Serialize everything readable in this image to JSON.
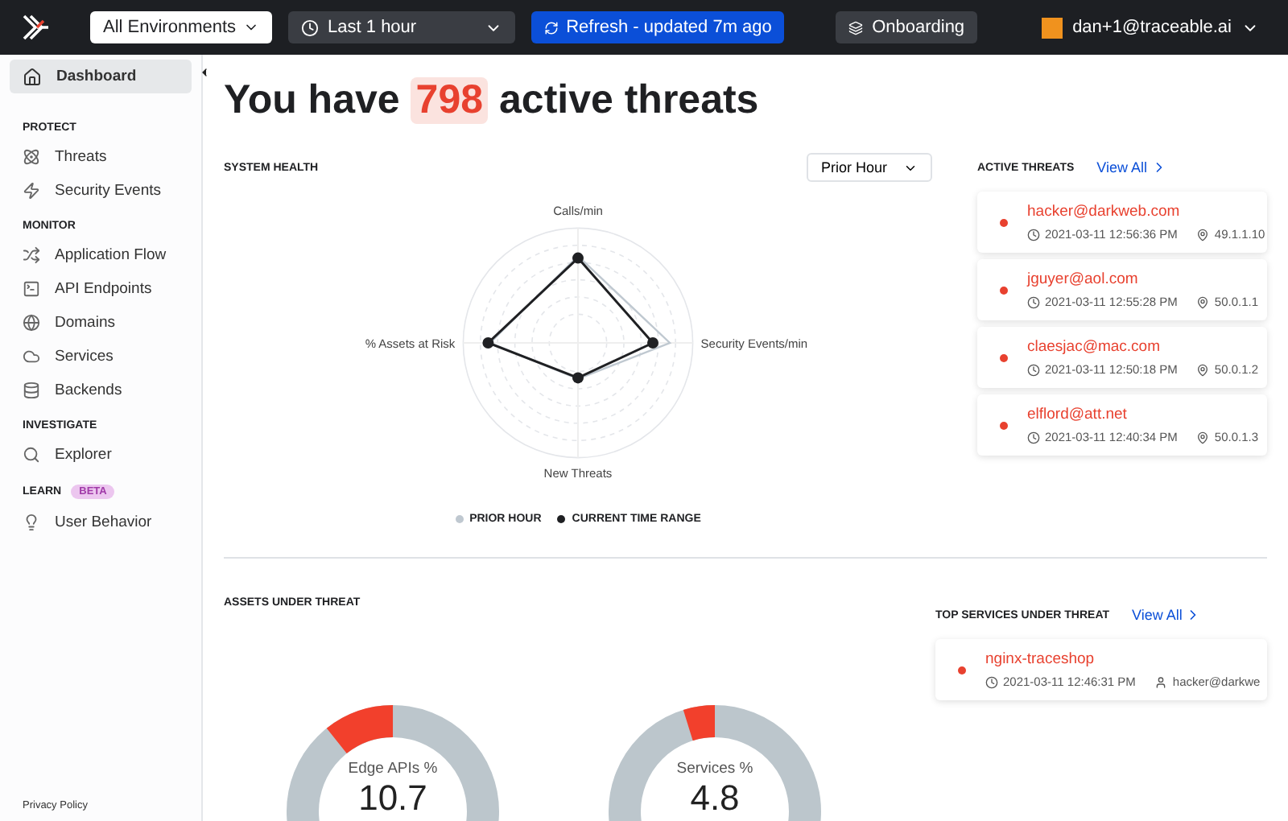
{
  "topbar": {
    "environment": "All Environments",
    "time_range": "Last 1 hour",
    "refresh": "Refresh - updated 7m ago",
    "onboarding": "Onboarding",
    "user": "dan+1@traceable.ai"
  },
  "sidebar": {
    "dashboard": {
      "label": "Dashboard",
      "selected": true
    },
    "sections": [
      {
        "title": "PROTECT",
        "items": [
          {
            "label": "Threats",
            "kind": "threats",
            "selected": false
          },
          {
            "label": "Security Events",
            "kind": "events",
            "selected": false
          }
        ]
      },
      {
        "title": "MONITOR",
        "items": [
          {
            "label": "Application Flow",
            "kind": "flow",
            "selected": false
          },
          {
            "label": "API Endpoints",
            "kind": "endpoints",
            "selected": false
          },
          {
            "label": "Domains",
            "kind": "domains",
            "selected": false
          },
          {
            "label": "Services",
            "kind": "services",
            "selected": false
          },
          {
            "label": "Backends",
            "kind": "backends",
            "selected": false
          }
        ]
      },
      {
        "title": "INVESTIGATE",
        "items": [
          {
            "label": "Explorer",
            "kind": "explorer",
            "selected": false
          }
        ]
      },
      {
        "title": "LEARN",
        "badge": "BETA",
        "items": [
          {
            "label": "User Behavior",
            "kind": "behavior",
            "selected": false
          }
        ]
      }
    ],
    "footer": "Privacy Policy"
  },
  "headline": {
    "before": "You have",
    "count": "798",
    "after": "active threats"
  },
  "system_health": {
    "title": "SYSTEM HEALTH",
    "period": "Prior Hour",
    "axes": [
      "Calls/min",
      "Security Events/min",
      "New Threats",
      "% Assets at Risk"
    ],
    "legend": [
      {
        "label": "PRIOR HOUR",
        "color": "#bfc8d0"
      },
      {
        "label": "CURRENT TIME RANGE",
        "color": "#1f2023"
      }
    ]
  },
  "active_threats": {
    "title": "ACTIVE THREATS",
    "link": "View All",
    "items": [
      {
        "name": "hacker@darkweb.com",
        "time": "2021-03-11 12:56:36 PM",
        "ip": "49.1.1.10",
        "color": "#e8412f"
      },
      {
        "name": "jguyer@aol.com",
        "time": "2021-03-11 12:55:28 PM",
        "ip": "50.0.1.1",
        "color": "#e8412f"
      },
      {
        "name": "claesjac@mac.com",
        "time": "2021-03-11 12:50:18 PM",
        "ip": "50.0.1.2",
        "color": "#e8412f"
      },
      {
        "name": "elflord@att.net",
        "time": "2021-03-11 12:40:34 PM",
        "ip": "50.0.1.3",
        "color": "#e8412f"
      }
    ]
  },
  "assets_under_threat": {
    "title": "ASSETS UNDER THREAT",
    "donuts": [
      {
        "label": "Edge APIs %",
        "value": "10.7",
        "level": 0.107
      },
      {
        "label": "Services %",
        "value": "4.8",
        "level": 0.048
      }
    ]
  },
  "top_services": {
    "title": "TOP SERVICES UNDER THREAT",
    "link": "View All",
    "items": [
      {
        "name": "nginx-traceshop",
        "time": "2021-03-11 12:46:31 PM",
        "user": "hacker@darkwe",
        "color": "#e8412f"
      }
    ]
  }
}
